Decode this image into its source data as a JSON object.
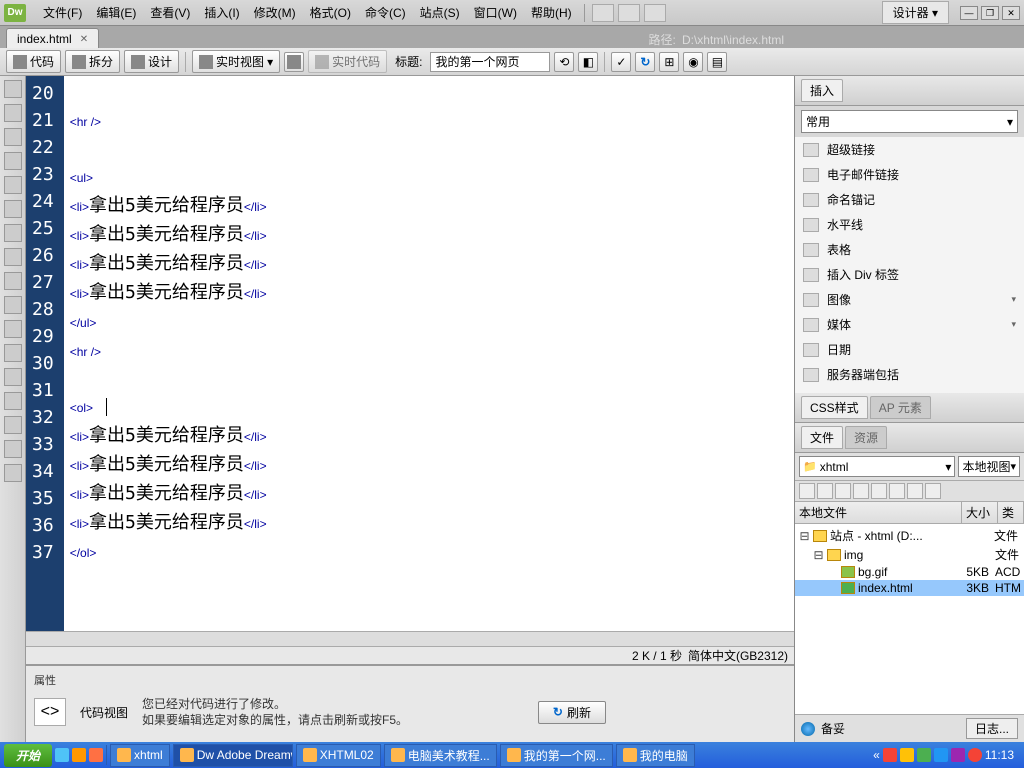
{
  "app": {
    "logo": "Dw",
    "designer": "设计器"
  },
  "menu": [
    "文件(F)",
    "编辑(E)",
    "查看(V)",
    "插入(I)",
    "修改(M)",
    "格式(O)",
    "命令(C)",
    "站点(S)",
    "窗口(W)",
    "帮助(H)"
  ],
  "tab": {
    "name": "index.html",
    "path_label": "路径:",
    "path": "D:\\xhtml\\index.html"
  },
  "toolbar": {
    "code": "代码",
    "split": "拆分",
    "design": "设计",
    "liveview": "实时视图",
    "livecode": "实时代码",
    "title_label": "标题:",
    "title_value": "我的第一个网页"
  },
  "code_lines": [
    {
      "n": 20,
      "t": ""
    },
    {
      "n": 21,
      "t": "<hr />"
    },
    {
      "n": 22,
      "t": ""
    },
    {
      "n": 23,
      "t": "<ul>"
    },
    {
      "n": 24,
      "t": "<li>拿出5美元给程序员</li>"
    },
    {
      "n": 25,
      "t": "<li>拿出5美元给程序员</li>"
    },
    {
      "n": 26,
      "t": "<li>拿出5美元给程序员</li>"
    },
    {
      "n": 27,
      "t": "<li>拿出5美元给程序员</li>"
    },
    {
      "n": 28,
      "t": "</ul>"
    },
    {
      "n": 29,
      "t": "<hr />"
    },
    {
      "n": 30,
      "t": ""
    },
    {
      "n": 31,
      "t": "<ol>"
    },
    {
      "n": 32,
      "t": "<li>拿出5美元给程序员</li>"
    },
    {
      "n": 33,
      "t": "<li>拿出5美元给程序员</li>"
    },
    {
      "n": 34,
      "t": "<li>拿出5美元给程序员</li>"
    },
    {
      "n": 35,
      "t": "<li>拿出5美元给程序员</li>"
    },
    {
      "n": 36,
      "t": "</ol>"
    },
    {
      "n": 37,
      "t": ""
    }
  ],
  "status": {
    "size": "2 K / 1 秒",
    "encoding": "简体中文(GB2312)"
  },
  "properties": {
    "title": "属性",
    "label": "代码视图",
    "line1": "您已经对代码进行了修改。",
    "line2": "如果要编辑选定对象的属性，请点击刷新或按F5。",
    "refresh": "刷新"
  },
  "insert_panel": {
    "title": "插入",
    "category": "常用",
    "items": [
      "超级链接",
      "电子邮件链接",
      "命名锚记",
      "水平线",
      "表格",
      "插入 Div 标签",
      "图像",
      "媒体",
      "日期",
      "服务器端包括"
    ],
    "expandable": [
      6,
      7
    ]
  },
  "css_panel": {
    "tab1": "CSS样式",
    "tab2": "AP 元素"
  },
  "files_panel": {
    "tab1": "文件",
    "tab2": "资源",
    "site_select": "xhtml",
    "view_select": "本地视图",
    "col_file": "本地文件",
    "col_size": "大小",
    "col_type": "类",
    "root": "站点 - xhtml (D:...",
    "root_type": "文件",
    "tree": [
      {
        "name": "img",
        "indent": 1,
        "type": "folder",
        "size": "",
        "ftype": "文件"
      },
      {
        "name": "bg.gif",
        "indent": 2,
        "type": "gif",
        "size": "5KB",
        "ftype": "ACD"
      },
      {
        "name": "index.html",
        "indent": 2,
        "type": "html",
        "size": "3KB",
        "ftype": "HTM",
        "selected": true
      }
    ],
    "ready": "备妥",
    "log": "日志..."
  },
  "taskbar": {
    "start": "开始",
    "items": [
      "xhtml",
      "Adobe Dreamw...",
      "XHTML02",
      "电脑美术教程...",
      "我的第一个网...",
      "我的电脑"
    ],
    "time": "11:13"
  }
}
